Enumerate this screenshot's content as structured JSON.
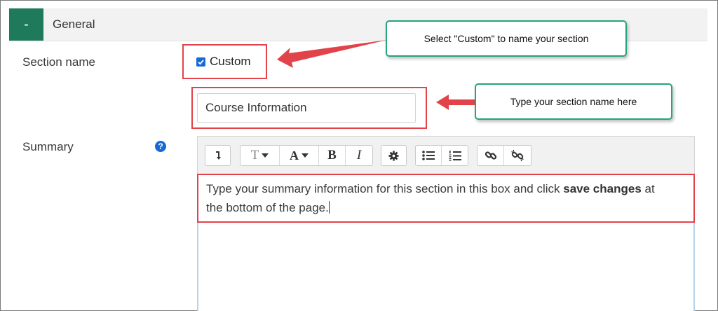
{
  "section": {
    "collapse_symbol": "-",
    "title": "General"
  },
  "section_name": {
    "label": "Section name",
    "checkbox_label": "Custom",
    "checked": true,
    "input_value": "Course Information"
  },
  "summary": {
    "label": "Summary",
    "help_symbol": "?",
    "text_before": "Type your summary information for this section in this box and click ",
    "text_bold": "save changes",
    "text_after_line1": " at",
    "text_line2": "the bottom of the page."
  },
  "toolbar": {
    "groups": [
      [
        "collapse-toolbar-icon"
      ],
      [
        "text-style-icon",
        "font-color-icon",
        "bold-icon",
        "italic-icon"
      ],
      [
        "gear-icon"
      ],
      [
        "unordered-list-icon",
        "ordered-list-icon"
      ],
      [
        "link-icon",
        "unlink-icon"
      ]
    ],
    "bold_glyph": "B",
    "italic_glyph": "I",
    "font_color_glyph": "A",
    "text_style_glyph": "T"
  },
  "annotations": {
    "custom_callout": "Select \"Custom\" to name your section",
    "name_callout": "Type your section name here"
  },
  "colors": {
    "accent_green": "#1f7a5c",
    "annotation_red": "#e2434a",
    "callout_border": "#25a37e",
    "link_blue": "#1769d6"
  }
}
